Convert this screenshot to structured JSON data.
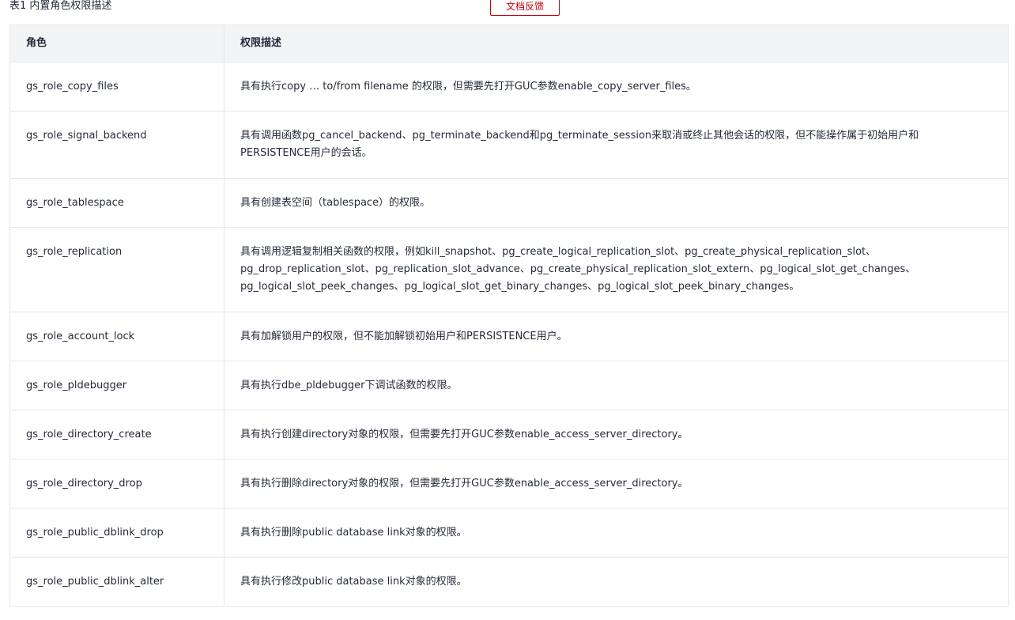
{
  "caption": "表1 内置角色权限描述",
  "feedback_button": "文档反馈",
  "table": {
    "headers": [
      "角色",
      "权限描述"
    ],
    "rows": [
      {
        "role": "gs_role_copy_files",
        "desc": "具有执行copy … to/from filename 的权限，但需要先打开GUC参数enable_copy_server_files。",
        "lines": 1
      },
      {
        "role": "gs_role_signal_backend",
        "desc": "具有调用函数pg_cancel_backend、pg_terminate_backend和pg_terminate_session来取消或终止其他会话的权限，但不能操作属于初始用户和PERSISTENCE用户的会话。",
        "lines": 2
      },
      {
        "role": "gs_role_tablespace",
        "desc": "具有创建表空间（tablespace）的权限。",
        "lines": 1
      },
      {
        "role": "gs_role_replication",
        "desc": "具有调用逻辑复制相关函数的权限，例如kill_snapshot、pg_create_logical_replication_slot、pg_create_physical_replication_slot、pg_drop_replication_slot、pg_replication_slot_advance、pg_create_physical_replication_slot_extern、pg_logical_slot_get_changes、pg_logical_slot_peek_changes、pg_logical_slot_get_binary_changes、pg_logical_slot_peek_binary_changes。",
        "lines": 3
      },
      {
        "role": "gs_role_account_lock",
        "desc": "具有加解锁用户的权限，但不能加解锁初始用户和PERSISTENCE用户。",
        "lines": 1
      },
      {
        "role": "gs_role_pldebugger",
        "desc": "具有执行dbe_pldebugger下调试函数的权限。",
        "lines": 1
      },
      {
        "role": "gs_role_directory_create",
        "desc": "具有执行创建directory对象的权限，但需要先打开GUC参数enable_access_server_directory。",
        "lines": 1
      },
      {
        "role": "gs_role_directory_drop",
        "desc": "具有执行删除directory对象的权限，但需要先打开GUC参数enable_access_server_directory。",
        "lines": 1
      },
      {
        "role": "gs_role_public_dblink_drop",
        "desc": "具有执行删除public database link对象的权限。",
        "lines": 1
      },
      {
        "role": "gs_role_public_dblink_alter",
        "desc": "具有执行修改public database link对象的权限。",
        "lines": 1
      }
    ]
  }
}
